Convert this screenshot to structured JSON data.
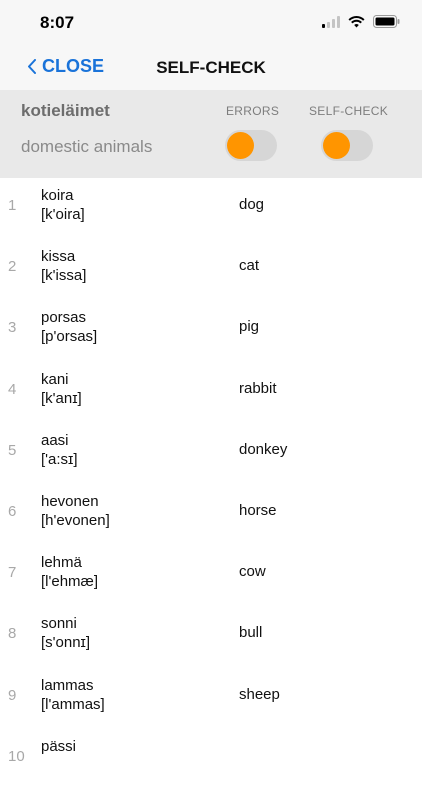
{
  "status": {
    "time": "8:07"
  },
  "nav": {
    "back_label": "CLOSE",
    "title": "SELF-CHECK"
  },
  "header": {
    "topic": "kotieläimet",
    "topic_translation": "domestic animals",
    "errors_label": "ERRORS",
    "selfcheck_label": "SELF-CHECK"
  },
  "colors": {
    "accent": "#1a73d9",
    "toggle_knob": "#ff9500"
  },
  "words": [
    {
      "num": "1",
      "word": "koira",
      "transcription": "[k'oira]",
      "meaning": "dog"
    },
    {
      "num": "2",
      "word": "kissa",
      "transcription": "[k'issa]",
      "meaning": "cat"
    },
    {
      "num": "3",
      "word": "porsas",
      "transcription": "[p'orsas]",
      "meaning": "pig"
    },
    {
      "num": "4",
      "word": "kani",
      "transcription": "[k'anɪ]",
      "meaning": "rabbit"
    },
    {
      "num": "5",
      "word": "aasi",
      "transcription": "['a:sɪ]",
      "meaning": "donkey"
    },
    {
      "num": "6",
      "word": "hevonen",
      "transcription": "[h'evonen]",
      "meaning": "horse"
    },
    {
      "num": "7",
      "word": "lehmä",
      "transcription": "[l'ehmæ]",
      "meaning": "cow"
    },
    {
      "num": "8",
      "word": "sonni",
      "transcription": "[s'onnɪ]",
      "meaning": "bull"
    },
    {
      "num": "9",
      "word": "lammas",
      "transcription": "[l'ammas]",
      "meaning": "sheep"
    },
    {
      "num": "10",
      "word": "pässi",
      "transcription": "",
      "meaning": ""
    }
  ]
}
